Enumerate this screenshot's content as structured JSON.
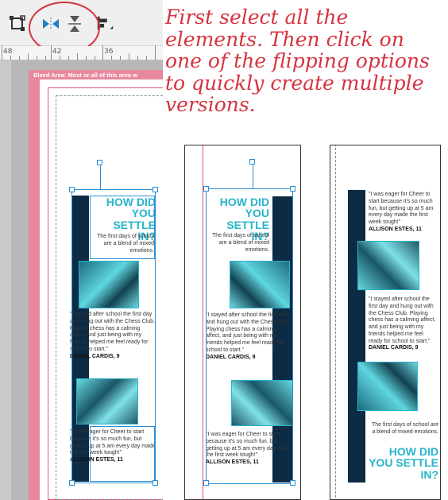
{
  "caption": {
    "text": "First select all the elements. Then click on one of the flipping options to quickly create multiple versions."
  },
  "editor": {
    "toolbar": {
      "icons": [
        "crop-frame-icon",
        "flip-horizontal-icon",
        "flip-vertical-icon",
        "align-icon"
      ]
    },
    "ruler": {
      "labels": [
        "48",
        "42",
        "36"
      ]
    },
    "bleed_text": "Bleed Area: Most or all of this area w"
  },
  "content": {
    "heading": "HOW DID YOU SETTLE IN?",
    "intro": "The first days of school are a blend of mixed emotions.",
    "quote1": {
      "text": "\"I stayed after school the first day and hung out with the Chess Club. Playing chess has a calming affect, and just being with my friends helped me feel ready for school to start.\"",
      "name": "DANIEL CARDIS, 9"
    },
    "quote2": {
      "text": "\"I was eager for Cheer to start because it's so much fun, but getting up at 5 am every day made the first week tough!\"",
      "name": "ALLISON ESTES, 11"
    }
  },
  "colors": {
    "accent": "#27b5cb",
    "dark_bar": "#0c2b45",
    "bleed": "#e8889f",
    "annotation": "#d5333f",
    "selection": "#2a8fd6"
  }
}
